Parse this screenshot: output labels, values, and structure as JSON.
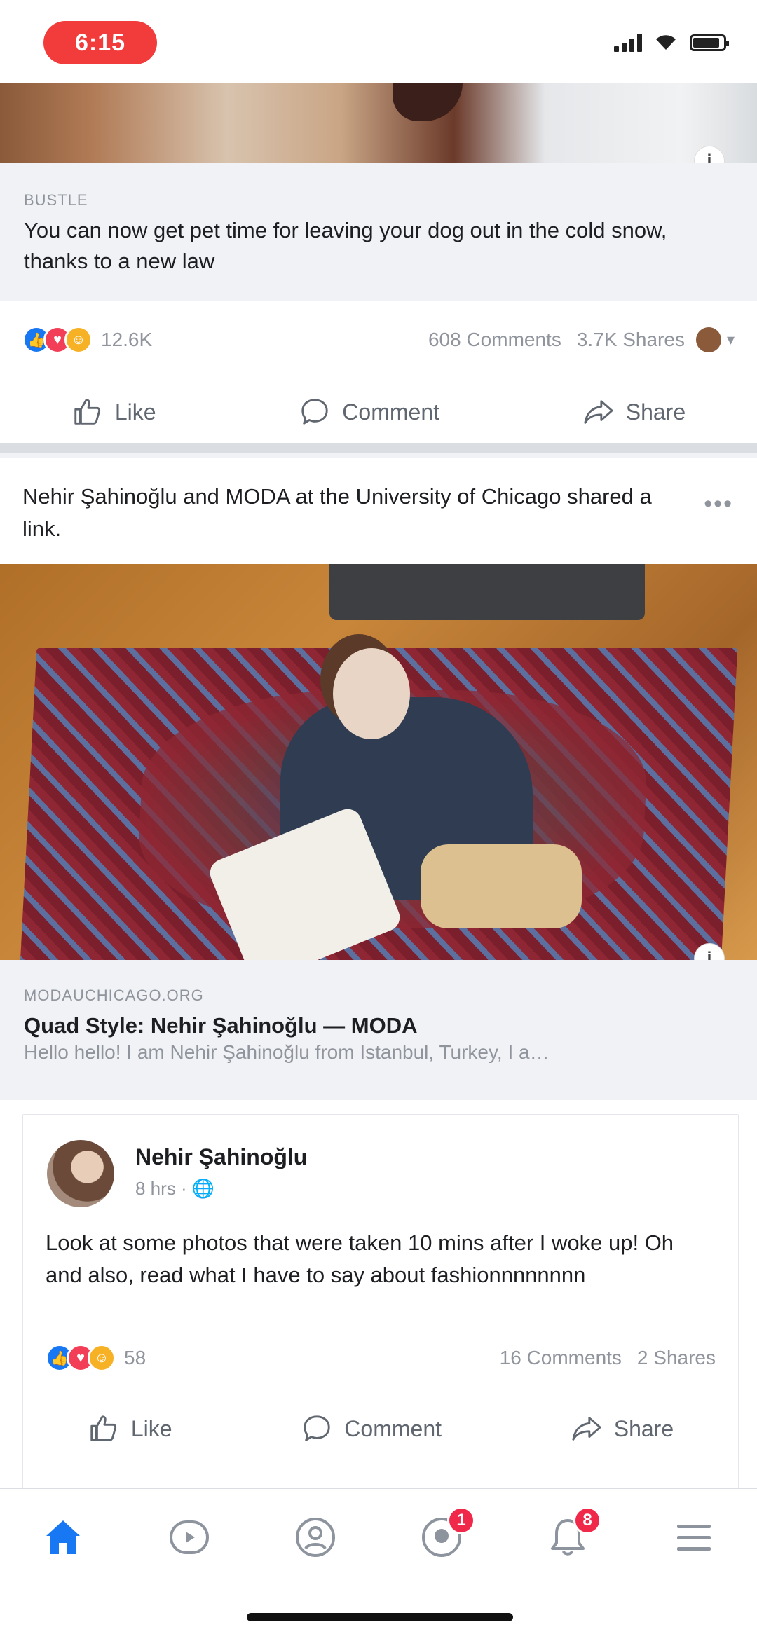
{
  "status_bar": {
    "time": "6:15"
  },
  "post1": {
    "link_domain": "BUSTLE",
    "link_title": "You can now get pet time for leaving your dog out in the cold snow, thanks to a new law",
    "reactions_count": "12.6K",
    "comments": "608 Comments",
    "shares": "3.7K Shares"
  },
  "post2": {
    "header": "Nehir Şahinoğlu and MODA at the University of Chicago shared a link.",
    "link_domain": "MODAUCHICAGO.ORG",
    "link_title": "Quad Style: Nehir Şahinoğlu — MODA",
    "link_desc": "Hello hello! I am Nehir Şahinoğlu from Istanbul, Turkey, I a…",
    "shared_post": {
      "author": "Nehir Şahinoğlu",
      "time": "8 hrs · 🌐",
      "text": "Look at some photos that were taken 10 mins after I woke up! Oh and also, read what I have to say about fashionnnnnnnn",
      "reactions_count": "58",
      "comments": "16 Comments",
      "shares": "2 Shares"
    }
  },
  "actions": {
    "like": "Like",
    "comment": "Comment",
    "share": "Share"
  },
  "tabbar": {
    "items": [
      "home",
      "watch",
      "marketplace",
      "groups",
      "notifications",
      "menu"
    ],
    "groups_badge": "1",
    "notifications_badge": "8"
  },
  "colors": {
    "accent": "#1877f2",
    "badge": "#f02849",
    "time_pill": "#f23b3b"
  }
}
